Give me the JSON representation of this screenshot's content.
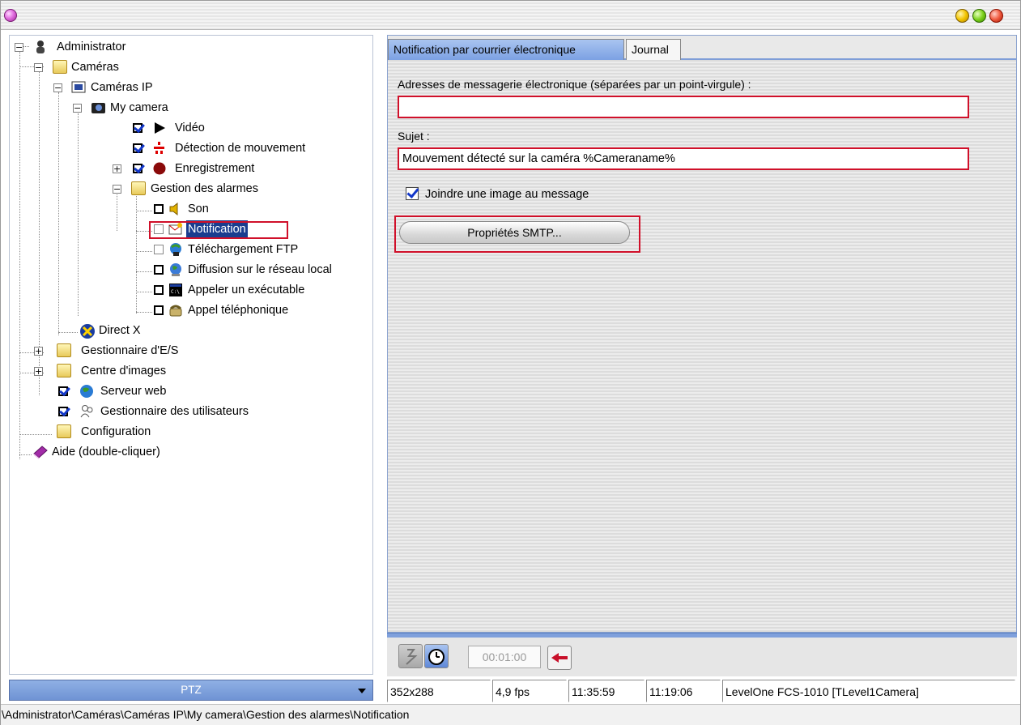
{
  "tree": {
    "items": [
      {
        "label": "Administrator"
      },
      {
        "label": "Caméras"
      },
      {
        "label": "Caméras IP"
      },
      {
        "label": "My camera"
      },
      {
        "label": "Vidéo"
      },
      {
        "label": "Détection de mouvement"
      },
      {
        "label": "Enregistrement"
      },
      {
        "label": "Gestion des alarmes"
      },
      {
        "label": "Son"
      },
      {
        "label": "Notification"
      },
      {
        "label": "Téléchargement FTP"
      },
      {
        "label": "Diffusion sur le réseau local"
      },
      {
        "label": "Appeler un exécutable"
      },
      {
        "label": "Appel téléphonique"
      },
      {
        "label": "Direct X"
      },
      {
        "label": "Gestionnaire d'E/S"
      },
      {
        "label": "Centre d'images"
      },
      {
        "label": "Serveur web"
      },
      {
        "label": "Gestionnaire des utilisateurs"
      },
      {
        "label": "Configuration"
      },
      {
        "label": "Aide (double-cliquer)"
      }
    ],
    "expander_minus": "−",
    "expander_plus": "+"
  },
  "ptz": {
    "label": "PTZ"
  },
  "tabs": [
    {
      "label": "Notification par courrier électronique"
    },
    {
      "label": "Journal"
    }
  ],
  "form": {
    "email_label": "Adresses de messagerie électronique (séparées par un point-virgule) :",
    "email_value": "",
    "subject_label": "Sujet :",
    "subject_value": "Mouvement détecté sur la caméra %Cameraname%",
    "attach_label": "Joindre une image au message",
    "attach_checked": true,
    "smtp_button": "Propriétés SMTP..."
  },
  "toolbar": {
    "time_value": "00:01:00"
  },
  "status": {
    "resolution": "352x288",
    "fps": "4,9 fps",
    "time1": "11:35:59",
    "time2": "11:19:06",
    "camera": "LevelOne FCS-1010 [TLevel1Camera]"
  },
  "path": "\\Administrator\\Caméras\\Caméras IP\\My camera\\Gestion des alarmes\\Notification",
  "colors": {
    "highlight_red": "#d0102a",
    "selection_blue": "#1a3d8f",
    "tab_active": "#7ca1e3"
  }
}
